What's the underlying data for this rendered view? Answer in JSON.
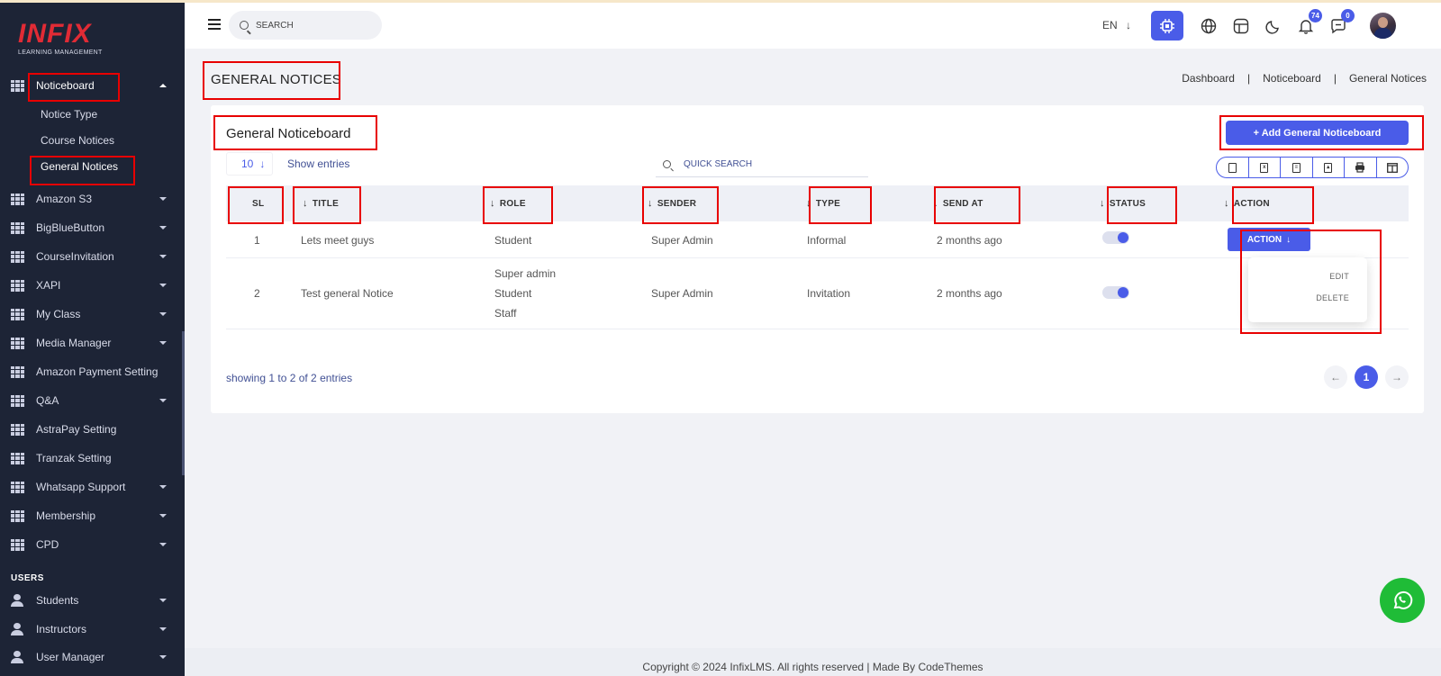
{
  "app": {
    "logo_text": "INFIX",
    "logo_subtitle": "LEARNING MANAGEMENT"
  },
  "sidebar": {
    "noticeboard": {
      "label": "Noticeboard",
      "subitems": [
        {
          "label": "Notice Type"
        },
        {
          "label": "Course Notices"
        },
        {
          "label": "General Notices"
        }
      ]
    },
    "items": [
      {
        "label": "Amazon S3",
        "caret": true
      },
      {
        "label": "BigBlueButton",
        "caret": true
      },
      {
        "label": "CourseInvitation",
        "caret": true
      },
      {
        "label": "XAPI",
        "caret": true
      },
      {
        "label": "My Class",
        "caret": true
      },
      {
        "label": "Media Manager",
        "caret": true
      },
      {
        "label": "Amazon Payment Setting",
        "caret": false
      },
      {
        "label": "Q&A",
        "caret": true
      },
      {
        "label": "AstraPay Setting",
        "caret": false
      },
      {
        "label": "Tranzak Setting",
        "caret": false
      },
      {
        "label": "Whatsapp Support",
        "caret": true
      },
      {
        "label": "Membership",
        "caret": true
      },
      {
        "label": "CPD",
        "caret": true
      }
    ],
    "users_heading": "USERS",
    "user_items": [
      {
        "label": "Students"
      },
      {
        "label": "Instructors"
      },
      {
        "label": "User Manager"
      }
    ]
  },
  "topbar": {
    "search_placeholder": "SEARCH",
    "language": "EN",
    "notifications_count": "74",
    "messages_count": "0"
  },
  "page": {
    "title": "GENERAL NOTICES",
    "breadcrumb": [
      "Dashboard",
      "Noticeboard",
      "General Notices"
    ]
  },
  "card": {
    "title": "General Noticeboard",
    "add_button": "+ Add General Noticeboard",
    "entries_value": "10",
    "entries_label": "Show entries",
    "quick_search_placeholder": "QUICK SEARCH",
    "columns": {
      "sl": "SL",
      "title": "TITLE",
      "role": "ROLE",
      "sender": "SENDER",
      "type": "TYPE",
      "send_at": "SEND AT",
      "status": "STATUS",
      "action": "ACTION"
    },
    "rows": [
      {
        "sl": "1",
        "title": "Lets meet guys",
        "roles": [
          "Student"
        ],
        "sender": "Super Admin",
        "type": "Informal",
        "send_at": "2 months ago"
      },
      {
        "sl": "2",
        "title": "Test general Notice",
        "roles": [
          "Super admin",
          "Student",
          "Staff"
        ],
        "sender": "Super Admin",
        "type": "Invitation",
        "send_at": "2 months ago"
      }
    ],
    "action_button": "ACTION",
    "action_menu": {
      "edit": "EDIT",
      "delete": "DELETE"
    },
    "showing_text": "showing 1 to 2 of 2 entries",
    "current_page": "1"
  },
  "footer": {
    "text": "Copyright © 2024 InfixLMS. All rights reserved | Made By CodeThemes"
  },
  "colors": {
    "accent": "#4a5ce8",
    "sidebar": "#1d2436",
    "highlight": "#e80000",
    "whatsapp": "#1fbc37"
  }
}
